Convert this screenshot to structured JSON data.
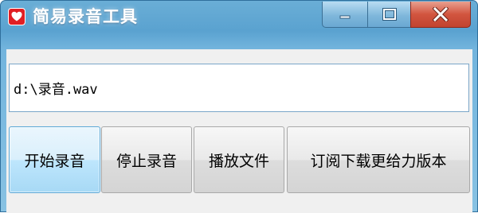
{
  "window": {
    "title": "简易录音工具",
    "accent_color": "#5aa2d0",
    "app_icon": "heart-icon",
    "controls": {
      "minimize_icon": "minimize-icon",
      "maximize_icon": "maximize-icon",
      "close_icon": "close-icon"
    }
  },
  "path_field": {
    "value": "d:\\录音.wav"
  },
  "buttons": {
    "start_label": "开始录音",
    "stop_label": "停止录音",
    "play_label": "播放文件",
    "subscribe_label": "订阅下载更给力版本"
  }
}
